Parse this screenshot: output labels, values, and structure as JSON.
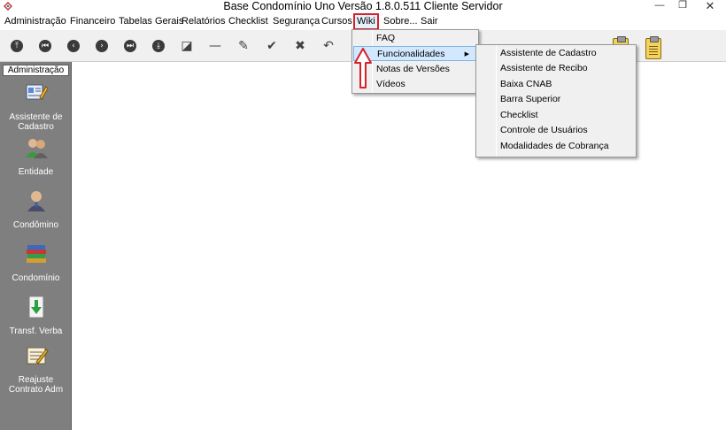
{
  "window": {
    "title": "Base Condomínio Uno Versão 1.8.0.511 Cliente Servidor",
    "minimize_glyph": "—",
    "maximize_glyph": "❐",
    "close_glyph": "✕"
  },
  "menubar": {
    "items": [
      "Administração",
      "Financeiro",
      "Tabelas Gerais",
      "Relatórios",
      "Checklist",
      "Segurança",
      "Cursos",
      "Wiki",
      "Sobre...",
      "Sair"
    ],
    "active": "Wiki"
  },
  "toolbar": {
    "buttons": [
      {
        "icon": "first-record-icon",
        "glyph": "⤒"
      },
      {
        "icon": "previous-page-icon",
        "glyph": "⏮"
      },
      {
        "icon": "previous-record-icon",
        "glyph": "‹"
      },
      {
        "icon": "next-record-icon",
        "glyph": "›"
      },
      {
        "icon": "next-page-icon",
        "glyph": "⏭"
      },
      {
        "icon": "last-record-icon",
        "glyph": "⤓"
      },
      {
        "icon": "new-record-icon",
        "glyph": "◪"
      },
      {
        "icon": "delete-record-icon",
        "glyph": "—"
      },
      {
        "icon": "edit-record-icon",
        "glyph": "✎"
      },
      {
        "icon": "confirm-icon",
        "glyph": "✔"
      },
      {
        "icon": "cancel-icon",
        "glyph": "✖"
      },
      {
        "icon": "undo-icon",
        "glyph": "↶"
      }
    ]
  },
  "sidebar": {
    "header": "Administração",
    "items": [
      {
        "label": "Assistente de Cadastro",
        "icon": "wizard-icon"
      },
      {
        "label": "Entidade",
        "icon": "people-icon"
      },
      {
        "label": "Condômino",
        "icon": "person-icon"
      },
      {
        "label": "Condomínio",
        "icon": "books-icon"
      },
      {
        "label": "Transf. Verba",
        "icon": "transfer-icon"
      },
      {
        "label": "Reajuste Contrato Adm",
        "icon": "contract-icon"
      }
    ]
  },
  "wiki_menu": {
    "items": [
      "FAQ",
      "Funcionalidades",
      "Notas de Versões",
      "Vídeos"
    ],
    "highlighted": "Funcionalidades",
    "submenu_indicator": "▶"
  },
  "funcionalidades_submenu": {
    "items": [
      "Assistente de Cadastro",
      "Assistente de Recibo",
      "Baixa CNAB",
      "Barra Superior",
      "Checklist",
      "Controle de Usuários",
      "Modalidades de Cobrança"
    ]
  },
  "colors": {
    "sidebar_bg": "#7f7f7f",
    "highlight_box": "#d9202a",
    "menu_highlight": "#d1e8ff"
  }
}
